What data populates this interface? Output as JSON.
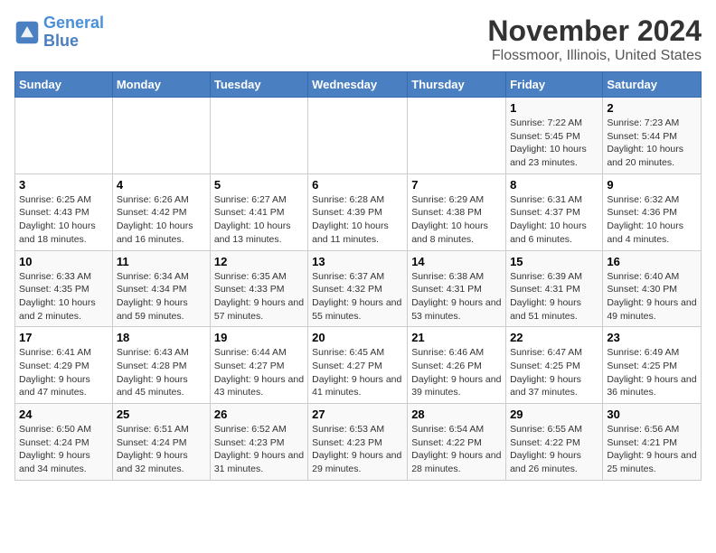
{
  "logo": {
    "line1": "General",
    "line2": "Blue"
  },
  "title": "November 2024",
  "location": "Flossmoor, Illinois, United States",
  "days_of_week": [
    "Sunday",
    "Monday",
    "Tuesday",
    "Wednesday",
    "Thursday",
    "Friday",
    "Saturday"
  ],
  "weeks": [
    [
      {
        "day": "",
        "info": ""
      },
      {
        "day": "",
        "info": ""
      },
      {
        "day": "",
        "info": ""
      },
      {
        "day": "",
        "info": ""
      },
      {
        "day": "",
        "info": ""
      },
      {
        "day": "1",
        "info": "Sunrise: 7:22 AM\nSunset: 5:45 PM\nDaylight: 10 hours and 23 minutes."
      },
      {
        "day": "2",
        "info": "Sunrise: 7:23 AM\nSunset: 5:44 PM\nDaylight: 10 hours and 20 minutes."
      }
    ],
    [
      {
        "day": "3",
        "info": "Sunrise: 6:25 AM\nSunset: 4:43 PM\nDaylight: 10 hours and 18 minutes."
      },
      {
        "day": "4",
        "info": "Sunrise: 6:26 AM\nSunset: 4:42 PM\nDaylight: 10 hours and 16 minutes."
      },
      {
        "day": "5",
        "info": "Sunrise: 6:27 AM\nSunset: 4:41 PM\nDaylight: 10 hours and 13 minutes."
      },
      {
        "day": "6",
        "info": "Sunrise: 6:28 AM\nSunset: 4:39 PM\nDaylight: 10 hours and 11 minutes."
      },
      {
        "day": "7",
        "info": "Sunrise: 6:29 AM\nSunset: 4:38 PM\nDaylight: 10 hours and 8 minutes."
      },
      {
        "day": "8",
        "info": "Sunrise: 6:31 AM\nSunset: 4:37 PM\nDaylight: 10 hours and 6 minutes."
      },
      {
        "day": "9",
        "info": "Sunrise: 6:32 AM\nSunset: 4:36 PM\nDaylight: 10 hours and 4 minutes."
      }
    ],
    [
      {
        "day": "10",
        "info": "Sunrise: 6:33 AM\nSunset: 4:35 PM\nDaylight: 10 hours and 2 minutes."
      },
      {
        "day": "11",
        "info": "Sunrise: 6:34 AM\nSunset: 4:34 PM\nDaylight: 9 hours and 59 minutes."
      },
      {
        "day": "12",
        "info": "Sunrise: 6:35 AM\nSunset: 4:33 PM\nDaylight: 9 hours and 57 minutes."
      },
      {
        "day": "13",
        "info": "Sunrise: 6:37 AM\nSunset: 4:32 PM\nDaylight: 9 hours and 55 minutes."
      },
      {
        "day": "14",
        "info": "Sunrise: 6:38 AM\nSunset: 4:31 PM\nDaylight: 9 hours and 53 minutes."
      },
      {
        "day": "15",
        "info": "Sunrise: 6:39 AM\nSunset: 4:31 PM\nDaylight: 9 hours and 51 minutes."
      },
      {
        "day": "16",
        "info": "Sunrise: 6:40 AM\nSunset: 4:30 PM\nDaylight: 9 hours and 49 minutes."
      }
    ],
    [
      {
        "day": "17",
        "info": "Sunrise: 6:41 AM\nSunset: 4:29 PM\nDaylight: 9 hours and 47 minutes."
      },
      {
        "day": "18",
        "info": "Sunrise: 6:43 AM\nSunset: 4:28 PM\nDaylight: 9 hours and 45 minutes."
      },
      {
        "day": "19",
        "info": "Sunrise: 6:44 AM\nSunset: 4:27 PM\nDaylight: 9 hours and 43 minutes."
      },
      {
        "day": "20",
        "info": "Sunrise: 6:45 AM\nSunset: 4:27 PM\nDaylight: 9 hours and 41 minutes."
      },
      {
        "day": "21",
        "info": "Sunrise: 6:46 AM\nSunset: 4:26 PM\nDaylight: 9 hours and 39 minutes."
      },
      {
        "day": "22",
        "info": "Sunrise: 6:47 AM\nSunset: 4:25 PM\nDaylight: 9 hours and 37 minutes."
      },
      {
        "day": "23",
        "info": "Sunrise: 6:49 AM\nSunset: 4:25 PM\nDaylight: 9 hours and 36 minutes."
      }
    ],
    [
      {
        "day": "24",
        "info": "Sunrise: 6:50 AM\nSunset: 4:24 PM\nDaylight: 9 hours and 34 minutes."
      },
      {
        "day": "25",
        "info": "Sunrise: 6:51 AM\nSunset: 4:24 PM\nDaylight: 9 hours and 32 minutes."
      },
      {
        "day": "26",
        "info": "Sunrise: 6:52 AM\nSunset: 4:23 PM\nDaylight: 9 hours and 31 minutes."
      },
      {
        "day": "27",
        "info": "Sunrise: 6:53 AM\nSunset: 4:23 PM\nDaylight: 9 hours and 29 minutes."
      },
      {
        "day": "28",
        "info": "Sunrise: 6:54 AM\nSunset: 4:22 PM\nDaylight: 9 hours and 28 minutes."
      },
      {
        "day": "29",
        "info": "Sunrise: 6:55 AM\nSunset: 4:22 PM\nDaylight: 9 hours and 26 minutes."
      },
      {
        "day": "30",
        "info": "Sunrise: 6:56 AM\nSunset: 4:21 PM\nDaylight: 9 hours and 25 minutes."
      }
    ]
  ]
}
